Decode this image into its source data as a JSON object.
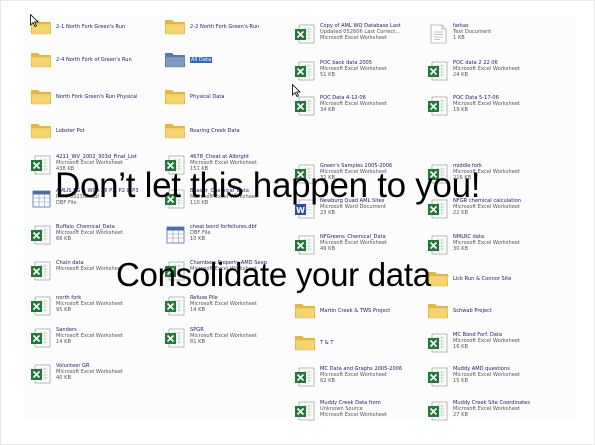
{
  "slide": {
    "headline": "Don’t let this happen to you!",
    "subheadline": "Consolidate your data"
  },
  "colors": {
    "folder": "#f5d470",
    "folder_dark": "#e0b840",
    "excel_green": "#1f7a3a",
    "selection": "#316ac5",
    "word_blue": "#2b4ea8"
  },
  "files": [
    {
      "icon": "folder",
      "lines": [
        "2-1 North Fork Green's Run"
      ]
    },
    {
      "icon": "folder",
      "lines": [
        "2-2 North Fork Green's Run"
      ]
    },
    {
      "icon": "excel",
      "lines": [
        "Copy of AML WQ Database Last",
        "Updated 052606 Last Correct...",
        "Microsoft Excel Worksheet"
      ]
    },
    {
      "icon": "text",
      "lines": [
        "farkas",
        "Text Document",
        "1 KB"
      ]
    },
    {
      "icon": "folder",
      "lines": [
        "2-4 North Fork of Green's Run"
      ]
    },
    {
      "icon": "folder-blue",
      "lines": [
        "All Data"
      ]
    },
    {
      "icon": "excel",
      "lines": [
        "POC back data 2005",
        "Microsoft Excel Worksheet",
        "51 KB"
      ]
    },
    {
      "icon": "excel",
      "lines": [
        "POC data 2 22 06",
        "Microsoft Excel Worksheet",
        "24 KB"
      ]
    },
    {
      "icon": "folder",
      "lines": [
        "North Fork Green's Run Physical"
      ]
    },
    {
      "icon": "folder",
      "lines": [
        "Physical Data"
      ]
    },
    {
      "icon": "excel",
      "lines": [
        "POC Data 4-12-06",
        "Microsoft Excel Worksheet",
        "34 KB"
      ]
    },
    {
      "icon": "excel",
      "lines": [
        "POC Data 5-17-06",
        "Microsoft Excel Worksheet",
        "19 KB"
      ]
    },
    {
      "icon": "excel",
      "lines": [
        "4211_WV_2002_303d_Final_List",
        "Microsoft Excel Worksheet",
        "438 KB"
      ]
    },
    {
      "icon": "excel",
      "lines": [
        "4678_Cheat at Albright",
        "Microsoft Excel Worksheet",
        "151 KB"
      ]
    },
    {
      "icon": "excel",
      "lines": [
        "Green's Samples 2005-2006",
        "Microsoft Excel Worksheet",
        "32 KB"
      ]
    },
    {
      "icon": "excel",
      "lines": [
        "middle fork",
        "Microsoft Excel Worksheet",
        "216 KB"
      ]
    },
    {
      "icon": "dbf",
      "lines": [
        "AMLIS SG & WCA All P1, P2 & P3",
        "Data 032305.dbf",
        "DBF File"
      ]
    },
    {
      "icon": "excel",
      "lines": [
        "Beaver_Chemical_Data",
        "Microsoft Excel Worksheet",
        "110 KB"
      ]
    },
    {
      "icon": "word",
      "lines": [
        "Newburg Quad AML Sites",
        "Microsoft Word Document",
        "23 KB"
      ]
    },
    {
      "icon": "excel",
      "lines": [
        "NFGR chemical calculation",
        "Microsoft Excel Worksheet",
        "22 KB"
      ]
    },
    {
      "icon": "excel",
      "lines": [
        "Buffalo_Chemical_Data",
        "Microsoft Excel Worksheet",
        "66 KB"
      ]
    },
    {
      "icon": "dbf",
      "lines": [
        "cheat bond forfeitures.dbf",
        "DBF File",
        "10 KB"
      ]
    },
    {
      "icon": "excel",
      "lines": [
        "NFGreens_Chemical_Data",
        "Microsoft Excel Worksheet",
        "49 KB"
      ]
    },
    {
      "icon": "excel",
      "lines": [
        "NMLRC data",
        "Microsoft Excel Worksheet",
        "30 KB"
      ]
    },
    {
      "icon": "excel",
      "lines": [
        "north fork",
        "Microsoft Excel Worksheet",
        "95 KB"
      ]
    },
    {
      "icon": "excel",
      "lines": [
        "Refuse Pile",
        "Microsoft Excel Worksheet",
        "14 KB"
      ]
    },
    {
      "icon": "folder",
      "lines": [
        "Martin Creek & TWS Project"
      ]
    },
    {
      "icon": "folder",
      "lines": [
        "Schwab Project"
      ]
    },
    {
      "icon": "excel",
      "lines": [
        "Sanders",
        "Microsoft Excel Worksheet",
        "14 KB"
      ]
    },
    {
      "icon": "excel",
      "lines": [
        "SPGR",
        "Microsoft Excel Worksheet",
        "81 KB"
      ]
    },
    {
      "icon": "folder",
      "lines": [
        "T & T"
      ]
    },
    {
      "icon": "excel",
      "lines": [
        "MC Bond Forf. Data",
        "Microsoft Excel Worksheet",
        "16 KB"
      ]
    },
    {
      "icon": "excel",
      "lines": [
        "Volunteer GR",
        "Microsoft Excel Worksheet",
        "40 KB"
      ]
    },
    {
      "icon": "excel",
      "lines": [
        "MC Data and Graphs 2005-2006",
        "Microsoft Excel Worksheet",
        "62 KB"
      ]
    },
    {
      "icon": "excel",
      "lines": [
        "Muddy AMD questions",
        "Microsoft Excel Worksheet",
        "15 KB"
      ]
    },
    {
      "icon": "excel",
      "lines": [
        "Muddy Creek Data from",
        "Unknown Source",
        "Microsoft Excel Worksheet"
      ]
    },
    {
      "icon": "excel",
      "lines": [
        "Muddy Creek Site Coordinates",
        "Microsoft Excel Worksheet",
        "27 KB"
      ]
    },
    {
      "icon": "excel",
      "lines": [
        "Chain data",
        "Microsoft Excel Worksheet"
      ]
    },
    {
      "icon": "excel",
      "lines": [
        "Chambers Property AMD Seep",
        "Microsoft Excel Worksheet"
      ]
    },
    {
      "icon": "folder",
      "lines": [
        "Lobster Pot"
      ]
    },
    {
      "icon": "folder",
      "lines": [
        "Roaring Creek Data"
      ]
    },
    {
      "icon": "folder",
      "lines": [
        "Lick Run & Connor Site"
      ]
    }
  ]
}
